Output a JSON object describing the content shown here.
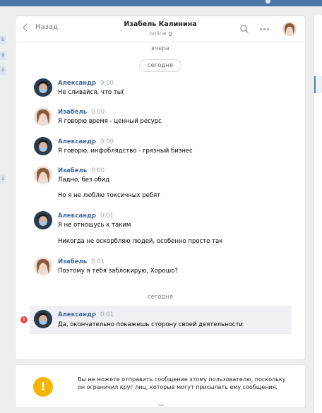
{
  "window": {
    "title": "Изабель Калинина"
  },
  "left_badges": [
    "5",
    "9",
    "2",
    "1"
  ],
  "header": {
    "back_label": "Назад",
    "peer_name": "Изабель Калинина",
    "peer_status": "online"
  },
  "separators": {
    "yesterday": "вчера",
    "today_pill": "сегодня",
    "today_text": "сегодня"
  },
  "messages": [
    {
      "author": "Александр",
      "time": "0:00",
      "lines": [
        "Не сливайся, что ты("
      ]
    },
    {
      "author": "Изабель",
      "time": "0:00",
      "lines": [
        "Я говорю время - ценный ресурс"
      ]
    },
    {
      "author": "Александр",
      "time": "0:00",
      "lines": [
        "Я говорю, инфоблядство - грязный бизнес"
      ]
    },
    {
      "author": "Изабель",
      "time": "0:00",
      "lines": [
        "Ладно, без обид",
        "Но я не люблю токсичных ребят"
      ]
    },
    {
      "author": "Александр",
      "time": "0:01",
      "lines": [
        "Я не отношусь к таким",
        "Никогда не оскорбляю людей, особенно просто так"
      ]
    },
    {
      "author": "Изабель",
      "time": "0:01",
      "lines": [
        "Поэтому я тебя заблокирую, Хорошо?"
      ]
    },
    {
      "author": "Александр",
      "time": "0:01",
      "lines": [
        "Да, окончательно покажешь сторону своей деятельности"
      ]
    }
  ],
  "notice": {
    "text": "Вы не можете отправить сообщение этому пользователю, поскольку он ограничил круг лиц, которые могут присылать ему сообщения."
  },
  "colors": {
    "accent": "#4a76a8",
    "author": "#3f6895",
    "warning": "#f5b400",
    "error": "#e64646"
  }
}
